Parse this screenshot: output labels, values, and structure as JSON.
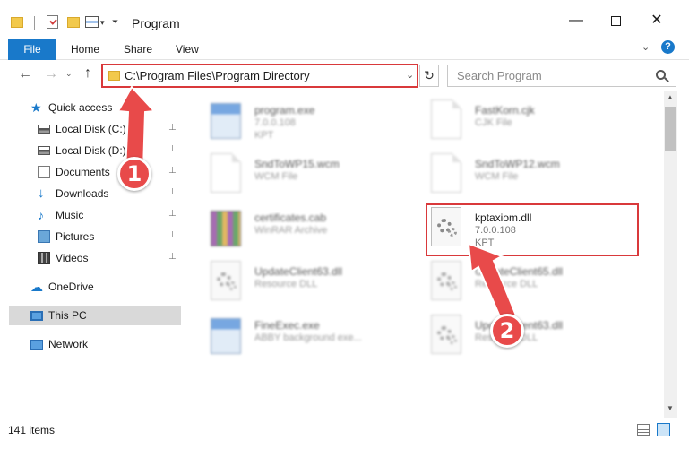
{
  "window": {
    "title": "Program",
    "minimize_glyph": "—",
    "close_glyph": "✕"
  },
  "ribbon": {
    "tabs": [
      "File",
      "Home",
      "Share",
      "View"
    ],
    "expand_glyph": "⌄",
    "help_glyph": "?"
  },
  "navigation": {
    "back_glyph": "←",
    "forward_glyph": "→",
    "recent_glyph": "⌄",
    "up_glyph": "↑",
    "address": "C:\\Program Files\\Program Directory",
    "address_dropdown_glyph": "⌄",
    "refresh_glyph": "↻",
    "search_placeholder": "Search Program"
  },
  "sidebar": {
    "items": [
      {
        "label": "Quick access",
        "icon": "star-icon",
        "pinned": false
      },
      {
        "label": "Local Disk (C:)",
        "icon": "disk-icon",
        "pinned": true
      },
      {
        "label": "Local Disk (D:)",
        "icon": "disk-icon",
        "pinned": true
      },
      {
        "label": "Documents",
        "icon": "documents-icon",
        "pinned": true
      },
      {
        "label": "Downloads",
        "icon": "downloads-icon",
        "pinned": true
      },
      {
        "label": "Music",
        "icon": "music-icon",
        "pinned": true
      },
      {
        "label": "Pictures",
        "icon": "pictures-icon",
        "pinned": true
      },
      {
        "label": "Videos",
        "icon": "videos-icon",
        "pinned": true
      },
      {
        "label": "OneDrive",
        "icon": "onedrive-icon",
        "pinned": false
      },
      {
        "label": "This PC",
        "icon": "this-pc-icon",
        "pinned": false,
        "selected": true
      },
      {
        "label": "Network",
        "icon": "network-icon",
        "pinned": false
      }
    ],
    "pin_glyph": "📌"
  },
  "files": [
    {
      "name": "program.exe",
      "line1": "7.0.0.108",
      "line2": "KPT",
      "icon": "exe-icon"
    },
    {
      "name": "FastKorn.cjk",
      "line1": "CJK File",
      "line2": "",
      "icon": "document-icon"
    },
    {
      "name": "SndToWP15.wcm",
      "line1": "WCM File",
      "line2": "",
      "icon": "document-icon"
    },
    {
      "name": "SndToWP12.wcm",
      "line1": "WCM File",
      "line2": "",
      "icon": "document-icon"
    },
    {
      "name": "certificates.cab",
      "line1": "WinRAR Archive",
      "line2": "",
      "icon": "winrar-icon"
    },
    {
      "name": "kptaxiom.dll",
      "line1": "7.0.0.108",
      "line2": "KPT",
      "icon": "dll-gear-icon",
      "highlighted": true
    },
    {
      "name": "UpdateClient63.dll",
      "line1": "Resource DLL",
      "line2": "",
      "icon": "dll-gear-icon"
    },
    {
      "name": "UpdateClient65.dll",
      "line1": "Resource DLL",
      "line2": "",
      "icon": "dll-gear-icon"
    },
    {
      "name": "FineExec.exe",
      "line1": "ABBY background exe...",
      "line2": "",
      "icon": "exe-icon"
    },
    {
      "name": "UpdateClient63.dll",
      "line1": "Resource DLL",
      "line2": "",
      "icon": "dll-gear-icon"
    }
  ],
  "status": {
    "item_count": "141 items"
  },
  "annotations": {
    "step1": "1",
    "step2": "2",
    "accent_color": "#e84a4a"
  },
  "colors": {
    "accent": "#1979ca",
    "highlight_border": "#d9393b"
  }
}
